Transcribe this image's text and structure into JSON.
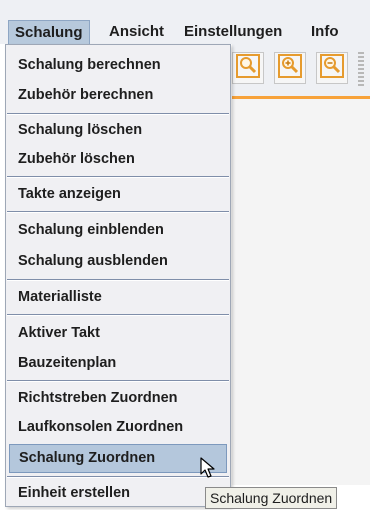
{
  "menubar": {
    "items": [
      {
        "label": "Schalung"
      },
      {
        "label": "Ansicht"
      },
      {
        "label": "Einstellungen"
      },
      {
        "label": "Info"
      }
    ]
  },
  "menu": {
    "items": [
      "Schalung berechnen",
      "Zubehör berechnen",
      "Schalung löschen",
      "Zubehör löschen",
      "Takte anzeigen",
      "Schalung einblenden",
      "Schalung ausblenden",
      "Materialliste",
      "Aktiver Takt",
      "Bauzeitenplan",
      "Richtstreben Zuordnen",
      "Laufkonsolen Zuordnen",
      "Schalung Zuordnen",
      "Einheit erstellen"
    ],
    "highlighted": "Schalung Zuordnen"
  },
  "toolbar": {
    "icons": [
      "zoom-icon",
      "zoom-in-icon",
      "zoom-out-icon"
    ]
  },
  "tooltip": {
    "text": "Schalung Zuordnen"
  },
  "colors": {
    "menu_highlight": "#b4c7dc",
    "toolbar_accent": "#f7a23a",
    "zoom_icon_frame": "#e69b2e"
  }
}
